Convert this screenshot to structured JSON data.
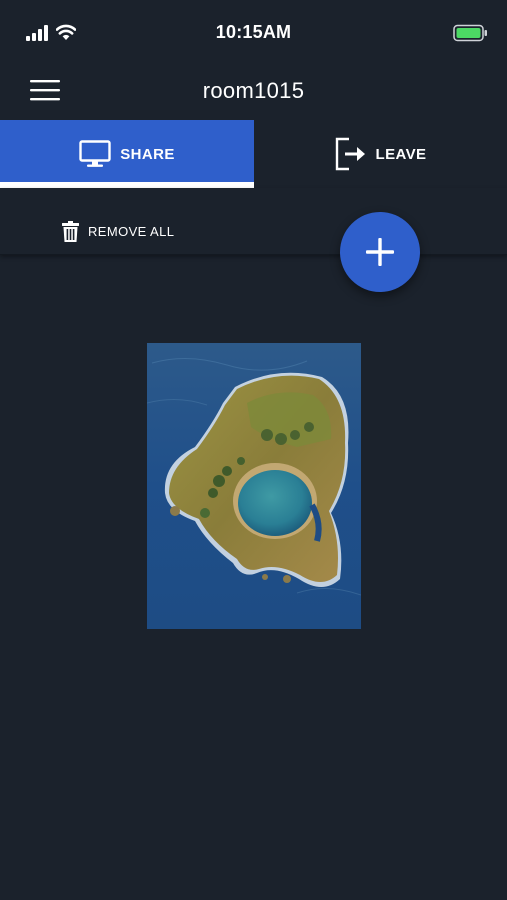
{
  "status_bar": {
    "time": "10:15AM",
    "signal_icon": "cellular-signal-icon",
    "wifi_icon": "wifi-icon",
    "battery_icon": "battery-icon",
    "battery_color": "#4cd964"
  },
  "header": {
    "menu_icon": "hamburger-menu-icon",
    "title": "room1015"
  },
  "tabs": [
    {
      "label": "SHARE",
      "icon": "monitor-icon",
      "active": true
    },
    {
      "label": "LEAVE",
      "icon": "exit-icon",
      "active": false
    }
  ],
  "toolbar": {
    "remove_all_label": "REMOVE ALL",
    "remove_all_icon": "trash-icon",
    "add_icon": "plus-icon"
  },
  "content": {
    "shared_image": "island-aerial-photo"
  },
  "colors": {
    "background": "#1b222c",
    "accent": "#2f5fcb",
    "text": "#ffffff"
  }
}
